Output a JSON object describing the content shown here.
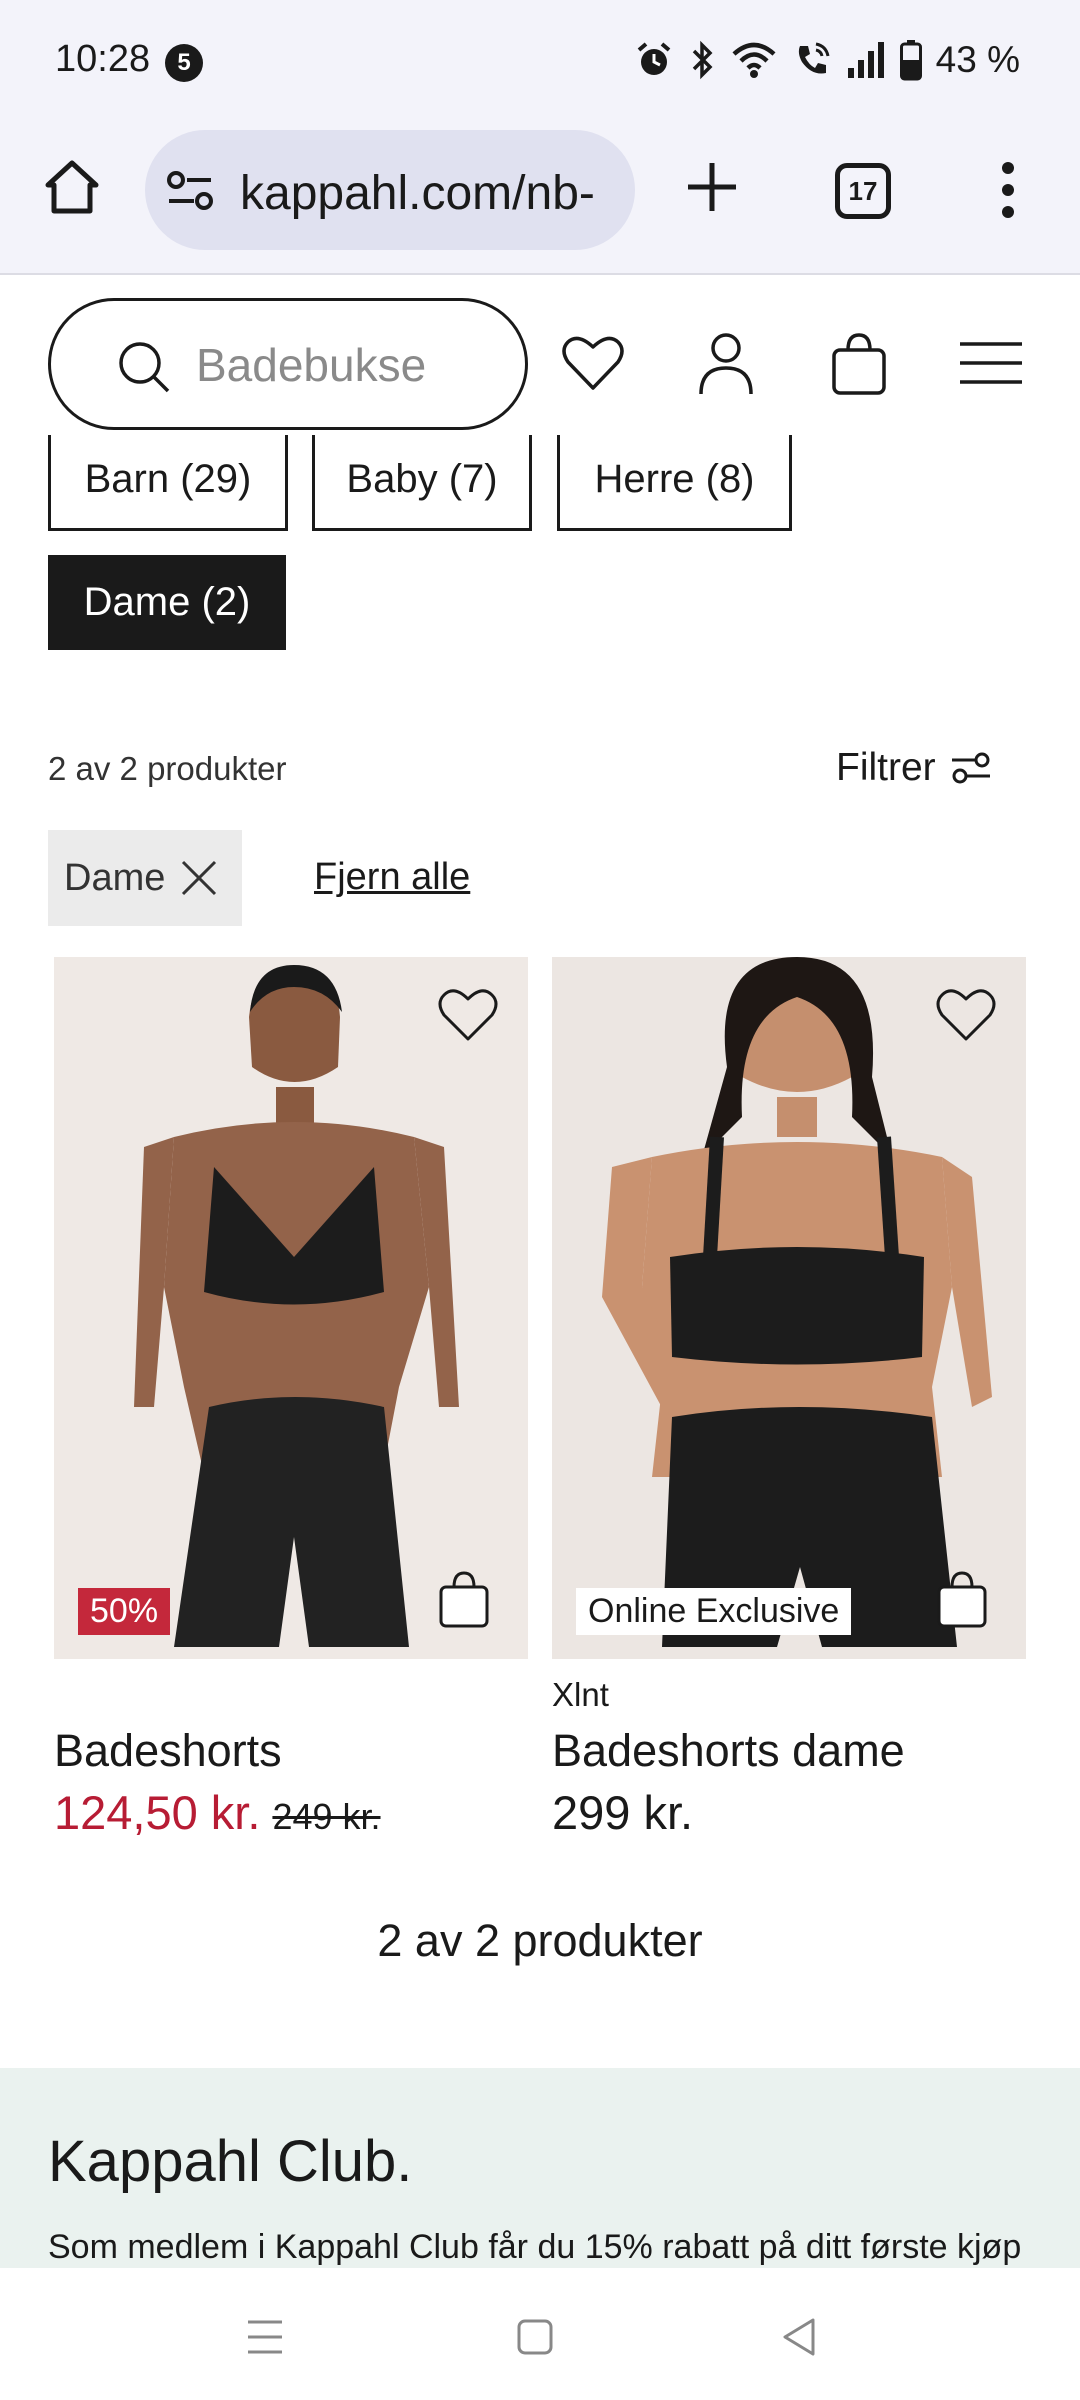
{
  "status": {
    "time": "10:28",
    "notification_count": "5",
    "battery": "43 %"
  },
  "browser": {
    "url": "kappahl.com/nb-",
    "tab_count": "17"
  },
  "header": {
    "search_placeholder": "Badebukse"
  },
  "categories": [
    {
      "label": "Barn (29)"
    },
    {
      "label": "Baby (7)"
    },
    {
      "label": "Herre (8)"
    },
    {
      "label": "Dame (2)"
    }
  ],
  "results": {
    "count_text": "2 av 2 produkter",
    "filter_label": "Filtrer",
    "active_filter": "Dame",
    "clear_all": "Fjern alle",
    "bottom_count": "2 av 2 produkter"
  },
  "products": [
    {
      "name": "Badeshorts",
      "badge": "50%",
      "price": "124,50 kr.",
      "old_price": "249 kr."
    },
    {
      "brand": "Xlnt",
      "name": "Badeshorts dame",
      "badge": "Online Exclusive",
      "price": "299 kr."
    }
  ],
  "club": {
    "title": "Kappahl Club.",
    "text": "Som medlem i Kappahl Club får du 15% rabatt på ditt første kjøp"
  },
  "colors": {
    "sale": "#c4283b",
    "club_bg": "#eaf2ef",
    "browser_bg": "#f3f3fa"
  }
}
